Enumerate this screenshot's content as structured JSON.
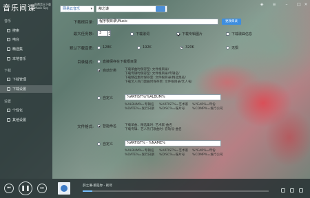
{
  "app": {
    "logo": "音乐间谍",
    "logo_sub": "免费音乐下载 Music Spy"
  },
  "sidebar": {
    "section_music": "音乐",
    "items_music": [
      {
        "label": "搜索"
      },
      {
        "label": "电台"
      },
      {
        "label": "精选集"
      },
      {
        "label": "本地音乐"
      }
    ],
    "section_download": "下载",
    "items_download": [
      {
        "label": "下载管理"
      },
      {
        "label": "下载设置"
      }
    ],
    "section_settings": "设置",
    "items_settings": [
      {
        "label": "个性化"
      },
      {
        "label": "其他设置"
      }
    ]
  },
  "header": {
    "source": "网易云音乐",
    "search_value": "薛之谦"
  },
  "settings": {
    "download_dir_label": "下载根目录:",
    "download_dir_value": "程序根目录\\Music",
    "change_dir_button": "更改目录",
    "max_tasks_label": "最大任务数:",
    "max_tasks_value": "3",
    "download_lyrics": "下载歌词",
    "download_album_cover": "下载专辑图片",
    "download_song_info": "下载歌曲信息",
    "quality_label": "默认下载音质:",
    "quality_options": [
      "128K",
      "192K",
      "320K",
      "无损"
    ],
    "quality_selected": "320K",
    "dir_format_label": "目录格式:",
    "dir_opt_root": "直接保存在下载根目录",
    "dir_opt_auto": "自动分类",
    "dir_auto_notes": [
      "下载单曲时保存至: 文件根目录/",
      "下载专辑时保存至: 文件根目录/专辑名/",
      "下载精选集时保存至: 文件根目录/精选集名/",
      "下载艺人热门歌曲时保存至: 文件根目录/艺人名/"
    ],
    "dir_opt_custom": "自定义",
    "dir_custom_value": "%ARTIST%/%ALBUM%",
    "dir_vars": [
      [
        "%ALBUM%=专辑名",
        "%ARTIST%=艺术家",
        "%YEAR%=年份"
      ],
      [
        "%DATE%=发行日期",
        "%DISC%=碟片号",
        "%COMP%=发行公司"
      ]
    ],
    "file_format_label": "文件格式:",
    "file_opt_smart": "智能命名",
    "file_smart_notes": [
      "下载单曲、精选集时: 艺术家-曲名",
      "下载专辑、艺人热门歌曲时: 音轨号-曲名"
    ],
    "file_opt_custom": "自定义",
    "file_custom_value": "%ARTIST% - %NAME%",
    "file_vars": [
      [
        "%ALBUM%=专辑名",
        "%ARTIST%=艺术家",
        "%YEAR%=年份"
      ],
      [
        "%DATE%=发行日期",
        "%DISC%=碟片号",
        "%COMP%=发行公司"
      ]
    ]
  },
  "player": {
    "now_playing": "薛之谦-那是你 - 耗尽",
    "progress": 0.05
  }
}
